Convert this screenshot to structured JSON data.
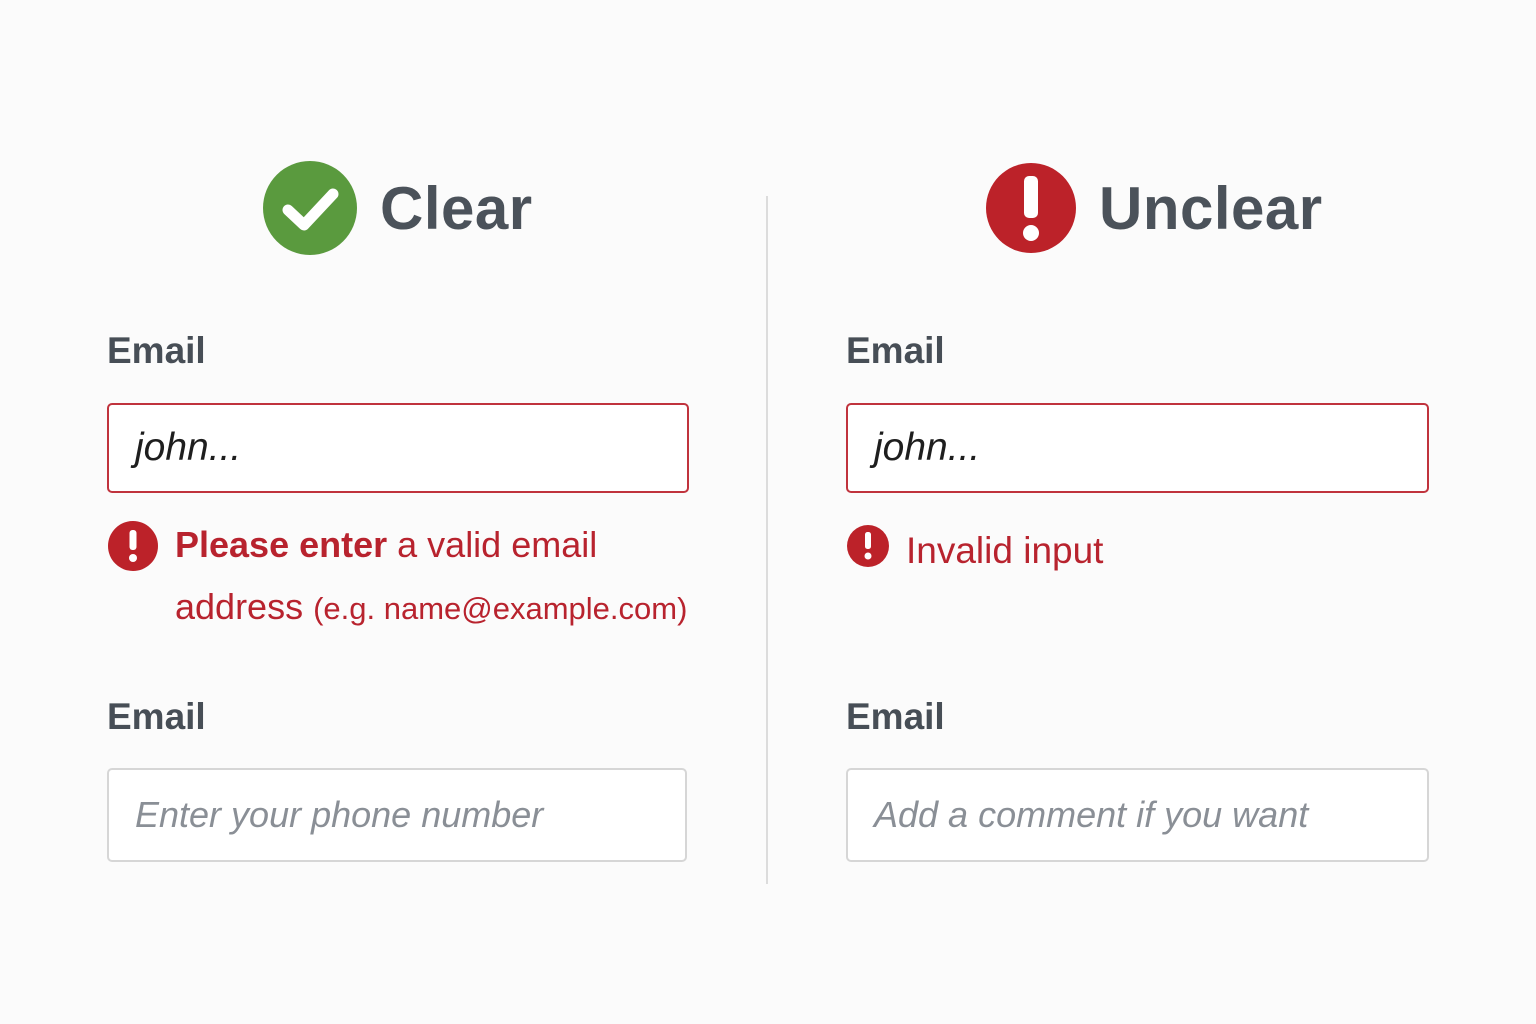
{
  "left": {
    "title": "Clear",
    "icon": "check-circle-icon",
    "icon_color": "#5a9a3e",
    "field1": {
      "label": "Email",
      "value": "john...",
      "error_strong": "Please enter",
      "error_rest": " a valid email",
      "error_line2": "address ",
      "error_example": "(e.g. name@example.com)"
    },
    "field2": {
      "label": "Email",
      "placeholder": "Enter your phone number"
    }
  },
  "right": {
    "title": "Unclear",
    "icon": "exclamation-circle-icon",
    "icon_color": "#bc2229",
    "field1": {
      "label": "Email",
      "value": "john...",
      "error": "Invalid input"
    },
    "field2": {
      "label": "Email",
      "placeholder": "Add a comment if you want"
    }
  },
  "colors": {
    "error": "#b8232e",
    "success": "#5a9a3e",
    "text": "#474e56",
    "border_error": "#c0333d",
    "border_normal": "#d6d6d6"
  }
}
